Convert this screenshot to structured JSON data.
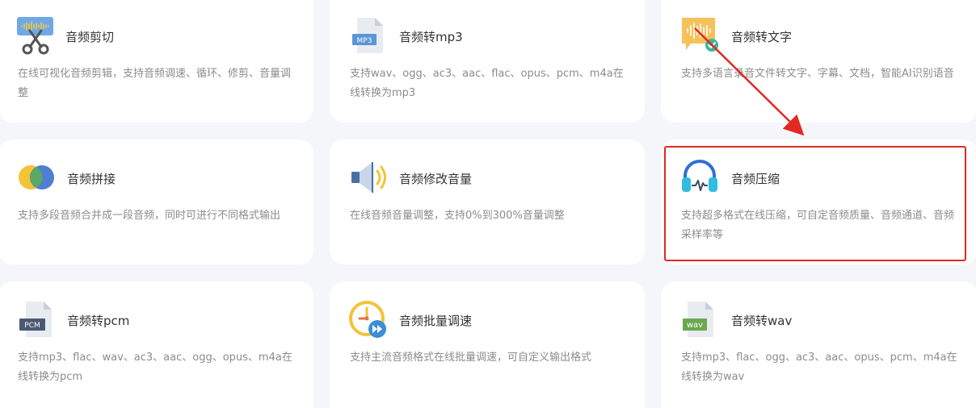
{
  "cards": [
    {
      "title": "音频剪切",
      "desc": "在线可视化音频剪辑，支持音频调速、循环、修剪、音量调整",
      "icon": "scissors-waveform-icon"
    },
    {
      "title": "音频转mp3",
      "desc": "支持wav、ogg、ac3、aac、flac、opus、pcm、m4a在线转换为mp3",
      "icon": "mp3-file-icon"
    },
    {
      "title": "音频转文字",
      "desc": "支持多语言录音文件转文字、字幕、文档，智能AI识别语音",
      "icon": "audio-to-text-icon"
    },
    {
      "title": "音频拼接",
      "desc": "支持多段音频合并成一段音频，同时可进行不同格式输出",
      "icon": "merge-circles-icon"
    },
    {
      "title": "音频修改音量",
      "desc": "在线音频音量调整，支持0%到300%音量调整",
      "icon": "speaker-volume-icon"
    },
    {
      "title": "音频压缩",
      "desc": "支持超多格式在线压缩，可自定音频质量、音频通道、音频采样率等",
      "icon": "headphones-icon"
    },
    {
      "title": "音频转pcm",
      "desc": "支持mp3、flac、wav、ac3、aac、ogg、opus、m4a在线转换为pcm",
      "icon": "pcm-file-icon"
    },
    {
      "title": "音频批量调速",
      "desc": "支持主流音频格式在线批量调速，可自定义输出格式",
      "icon": "stopwatch-fastforward-icon"
    },
    {
      "title": "音频转wav",
      "desc": "支持mp3、flac、ogg、ac3、aac、opus、pcm、m4a在线转换为wav",
      "icon": "wav-file-icon"
    }
  ],
  "file_badges": {
    "mp3": "MP3",
    "pcm": "PCM",
    "wav": "wav"
  },
  "colors": {
    "highlight": "#e02a22",
    "background": "#f5f6fa",
    "title": "#333333",
    "desc": "#8c8c8c"
  }
}
